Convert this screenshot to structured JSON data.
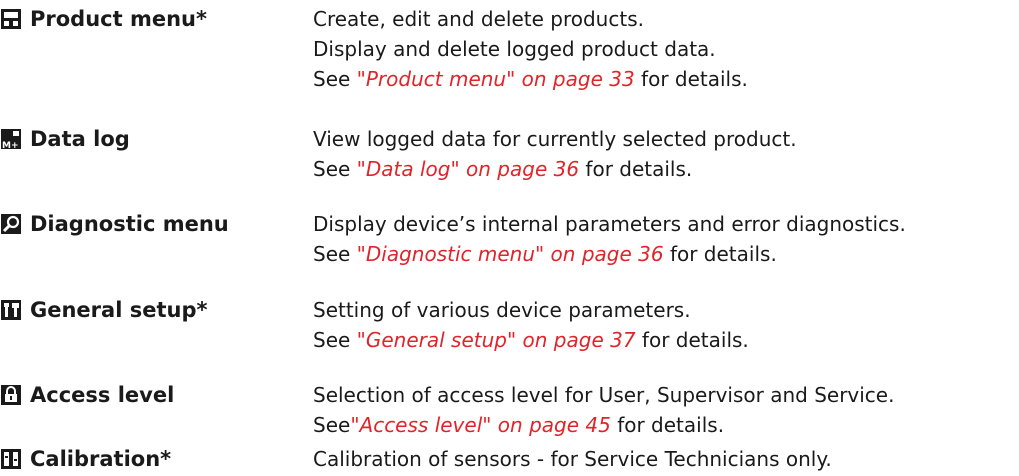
{
  "entries": [
    {
      "label": "Product menu*",
      "icon": "product-menu-icon",
      "lines": [
        "Create, edit and delete products.",
        "Display and delete logged product data."
      ],
      "see": {
        "pre": "See ",
        "link": "\"Product menu\" on page 33",
        "post": " for details."
      }
    },
    {
      "label": "Data log",
      "icon": "data-log-icon",
      "lines": [
        "View logged data for currently selected product."
      ],
      "see": {
        "pre": "See ",
        "link": "\"Data log\" on page 36",
        "post": " for details."
      }
    },
    {
      "label": "Diagnostic menu",
      "icon": "magnifier-icon",
      "lines": [
        "Display device’s internal parameters and error diagnostics."
      ],
      "see": {
        "pre": "See ",
        "link": "\"Diagnostic menu\" on page 36",
        "post": " for details."
      }
    },
    {
      "label": "General setup*",
      "icon": "tools-icon",
      "lines": [
        "Setting of various device parameters."
      ],
      "see": {
        "pre": "See ",
        "link": "\"General setup\" on page 37",
        "post": " for details."
      }
    },
    {
      "label": "Access level",
      "icon": "lock-icon",
      "lines": [
        "Selection of access level for User, Supervisor and Service."
      ],
      "see": {
        "pre": "See",
        "link": "\"Access level\" on page 45",
        "post": " for details."
      }
    },
    {
      "label": "Calibration*",
      "icon": "calibration-icon",
      "lines": [
        "Calibration of sensors - for Service Technicians only."
      ]
    }
  ],
  "colors": {
    "link": "#e0242a",
    "text": "#1a1a1a"
  }
}
